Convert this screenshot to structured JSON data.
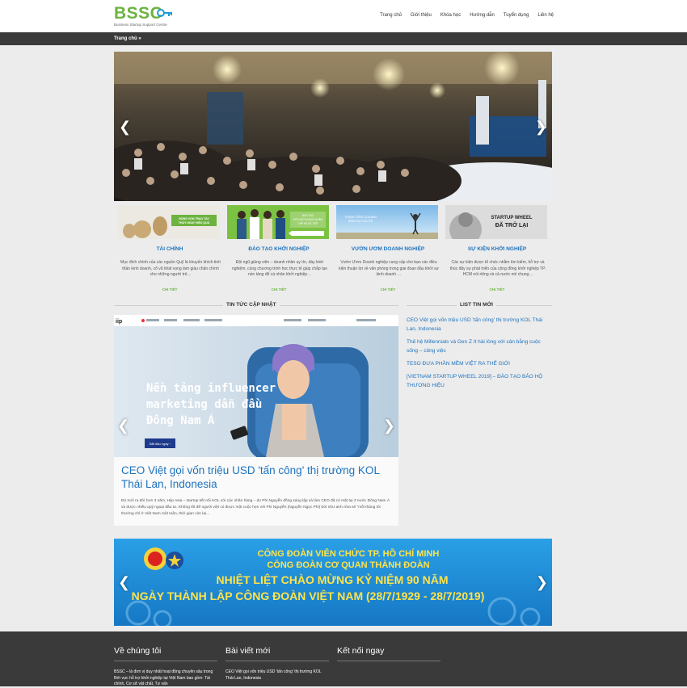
{
  "header": {
    "logo_text": "BSSC",
    "logo_sub": "Business Startup Support Centre",
    "nav": [
      "Trang chủ",
      "Giới thiệu",
      "Khóa học",
      "Hướng dẫn",
      "Tuyển dụng",
      "Liên hệ"
    ]
  },
  "breadcrumb": "Trang chủ »",
  "features": [
    {
      "title": "TÀI CHÍNH",
      "desc": "Mục đích chính của các nguồn Quỹ là khuyến khích tinh thần kinh doanh, cổ vũ khát vọng làm giàu chân chính cho những người trẻ…",
      "more": "CHI TIẾT",
      "img_caption": "ĐỒNG VỐN TRAO TAY THẤY NGAY HIỆU QUẢ"
    },
    {
      "title": "ĐÀO TẠO KHỞI NGHIỆP",
      "desc": "Đội ngũ giảng viên – doanh nhân uy tín, dày kinh nghiệm, cùng chương trình học thực tế giúp chắp tạo nền tảng để cá nhân khởi nghiệp…",
      "more": "CHI TIẾT",
      "img_caption": "ĐÀO TẠO ĐỘI NGŨ DOANH NHÂN THẾ HỆ KẾ TIẾP"
    },
    {
      "title": "VƯỜN ƯƠM DOANH NGHIỆP",
      "desc": "Vườn Ươm Doanh nghiệp cung cấp cho bạn các điều kiện thuận lợi về văn phòng trong giai đoạn đầu khởi sự kinh doanh …",
      "more": "CHI TIẾT",
      "img_caption": "THÀNH CÔNG CỦA BẠN NIỀM VUI CỦA TÔI"
    },
    {
      "title": "SỰ KIỆN KHỞI NGHIỆP",
      "desc": "Các sự kiện được tổ chức nhằm tìm kiếm, hỗ trợ và thúc đẩy sự phát triển của cộng đồng khởi nghiệp TP. HCM nói riêng và cả nước nói chung…",
      "more": "CHI TIẾT",
      "img_caption": "STARTUP WHEEL ĐÃ TRỞ LẠI"
    }
  ],
  "news": {
    "section_title": "TIN TỨC CẬP NHẬT",
    "slide_headline": "Nền tảng influencer marketing dẫn đầu Đông Nam Á",
    "slide_brand": "iip",
    "slide_button": "Bắt đầu ngay",
    "title": "CEO Việt gọi vốn triệu USD 'tấn công' thị trường KOL Thái Lan, Indonesia",
    "excerpt": "Đó mới ra đời hơn 3 năm, Hiip Asia – startup kết nối KOL với các nhãn hàng – do Phi Nguyễn đồng sáng lập và làm CEO đã có mặt tại 3 nước Đông Nam Á và được nhiều quỹ ngoại đầu tư. Không tốt để người việt có được một cuộc hẹn với Phi Nguyễn (Nguyễn Ngọc Phi) bởi như anh chia sẻ \"mỗi tháng tôi thường chỉ ở Việt Nam một tuần, thời gian còn lại..."
  },
  "list": {
    "section_title": "LIST TIN MỚI",
    "items": [
      "CEO Việt gọi vốn triệu USD 'tấn công' thị trường KOL Thái Lan, Indonesia",
      "Thế hệ Millennials và Gen Z ít hài lòng với cân bằng cuộc sống – công việc",
      "TESO ĐƯA PHẦN MỀM VIỆT RA THẾ GIỚI",
      "[VIETNAM STARTUP WHEEL 2019] – ĐÀO TẠO BẢO HỘ THƯƠNG HIỆU"
    ]
  },
  "banner": {
    "line1": "CÔNG ĐOÀN VIÊN CHỨC TP. HỒ CHÍ MINH",
    "line2": "CÔNG ĐOÀN CƠ QUAN THÀNH ĐOÀN",
    "line3": "NHIỆT LIỆT CHÀO MỪNG KỶ NIỆM 90 NĂM",
    "line4": "NGÀY THÀNH LẬP CÔNG ĐOÀN VIỆT NAM (28/7/1929 - 28/7/2019)"
  },
  "footer": {
    "about_title": "Về chúng tôi",
    "about_text": "BSSC – là đơn vị duy nhất hoạt động chuyên sâu trong lĩnh vực hỗ trợ khởi nghiệp tại Việt Nam bao gồm: Tài chính, Cơ sở vật chất, Tư vấn",
    "posts_title": "Bài viết mới",
    "posts_text": "CEO Việt gọi vốn triệu USD 'tấn công' thị trường KOL Thái Lan, Indonesia",
    "connect_title": "Kết nối ngay"
  },
  "colors": {
    "accent": "#1e73be",
    "brand_green": "#6cb33f",
    "dark_bar": "#3a3a3a",
    "banner_blue": "#1d8fd8"
  }
}
